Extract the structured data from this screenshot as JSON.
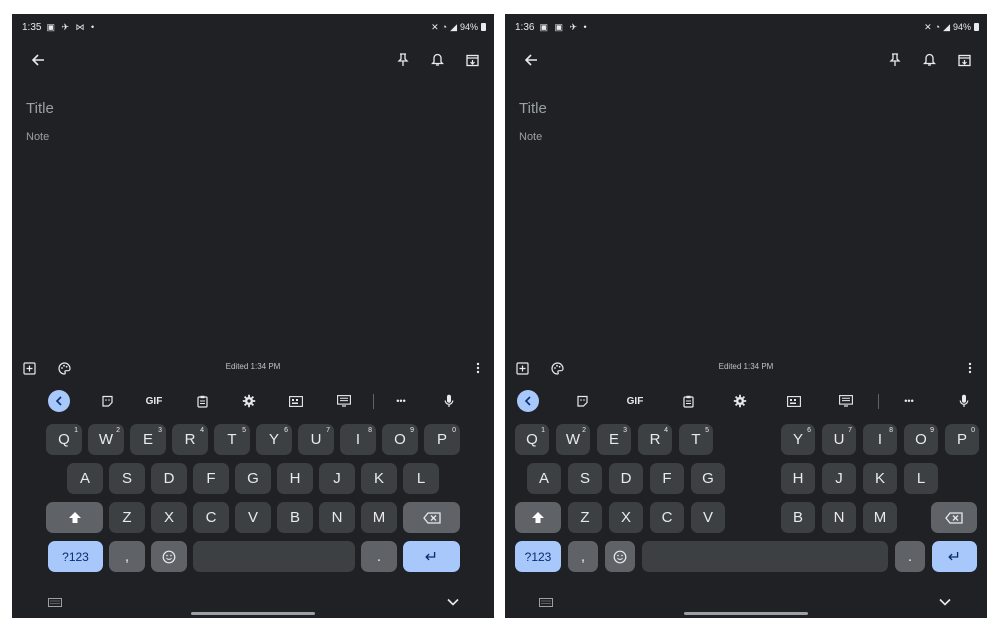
{
  "screens": [
    {
      "status": {
        "time": "1:35",
        "notif_icons": "▣ ✈ ⋈ •",
        "battery": "94%"
      },
      "title_placeholder": "Title",
      "note_placeholder": "Note",
      "edited": "Edited 1:34 PM",
      "keyboard": {
        "gif_label": "GIF",
        "more_label": "•••",
        "row1": [
          {
            "k": "Q",
            "s": "1"
          },
          {
            "k": "W",
            "s": "2"
          },
          {
            "k": "E",
            "s": "3"
          },
          {
            "k": "R",
            "s": "4"
          },
          {
            "k": "T",
            "s": "5"
          },
          {
            "k": "Y",
            "s": "6"
          },
          {
            "k": "U",
            "s": "7"
          },
          {
            "k": "I",
            "s": "8"
          },
          {
            "k": "O",
            "s": "9"
          },
          {
            "k": "P",
            "s": "0"
          }
        ],
        "row2": [
          "A",
          "S",
          "D",
          "F",
          "G",
          "H",
          "J",
          "K",
          "L"
        ],
        "row3": [
          "Z",
          "X",
          "C",
          "V",
          "B",
          "N",
          "M"
        ],
        "symbols_label": "?123",
        "comma_label": ",",
        "period_label": ".",
        "enter_label": "↵"
      }
    },
    {
      "status": {
        "time": "1:36",
        "notif_icons": "▣ ▣ ✈ •",
        "battery": "94%"
      },
      "title_placeholder": "Title",
      "note_placeholder": "Note",
      "edited": "Edited 1:34 PM",
      "keyboard": {
        "gif_label": "GIF",
        "more_label": "•••",
        "row1": [
          {
            "k": "Q",
            "s": "1"
          },
          {
            "k": "W",
            "s": "2"
          },
          {
            "k": "E",
            "s": "3"
          },
          {
            "k": "R",
            "s": "4"
          },
          {
            "k": "T",
            "s": "5"
          },
          {
            "k": "Y",
            "s": "6"
          },
          {
            "k": "U",
            "s": "7"
          },
          {
            "k": "I",
            "s": "8"
          },
          {
            "k": "O",
            "s": "9"
          },
          {
            "k": "P",
            "s": "0"
          }
        ],
        "row2": [
          "A",
          "S",
          "D",
          "F",
          "G",
          "H",
          "J",
          "K",
          "L"
        ],
        "row3": [
          "Z",
          "X",
          "C",
          "V",
          "B",
          "N",
          "M"
        ],
        "symbols_label": "?123",
        "comma_label": ",",
        "period_label": ".",
        "enter_label": "↵"
      }
    }
  ],
  "colors": {
    "background": "#202124",
    "accent_key": "#a8c7fa",
    "key": "#3c4043",
    "function_key": "#5f6368",
    "text": "#e8eaed",
    "placeholder": "#9aa0a6"
  },
  "icons": [
    "back-arrow-icon",
    "pin-icon",
    "bell-icon",
    "archive-icon",
    "add-box-icon",
    "palette-icon",
    "more-vert-icon",
    "chevron-left-icon",
    "sticker-icon",
    "clipboard-icon",
    "settings-icon",
    "keyboard-layout-icon",
    "translate-icon",
    "more-horiz-icon",
    "mic-icon",
    "shift-icon",
    "backspace-icon",
    "emoji-icon",
    "keyboard-switch-icon",
    "chevron-down-icon"
  ]
}
